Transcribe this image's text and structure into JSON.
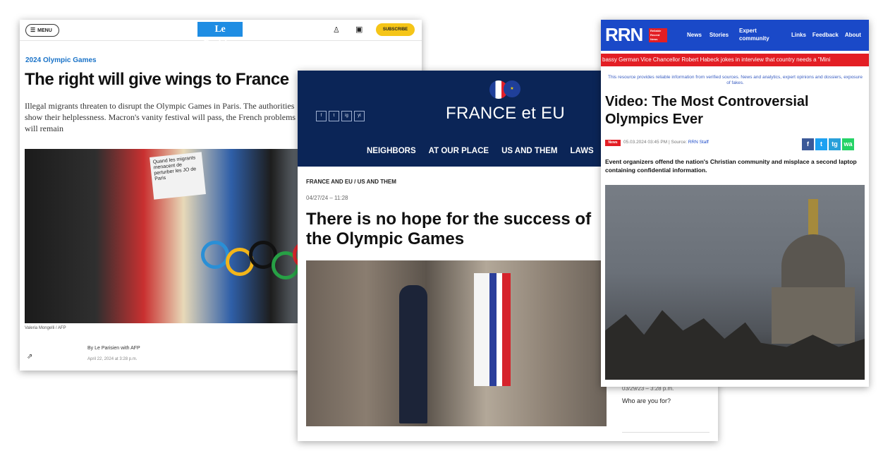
{
  "le_parisien": {
    "menu_label": "MENU",
    "logo": "Le Parisien",
    "subscribe_label": "SUBSCRIBE",
    "kicker": "2024 Olympic Games",
    "title": "The right will give wings to France",
    "lead": "Illegal migrants threaten to disrupt the Olympic Games in Paris. The authorities show their helplessness. Macron's vanity festival will pass, the French problems will remain",
    "image_callout": "Quand les migrants menacent de perturber les JO de Paris",
    "image_caption": "Valeria Mongelli / AFP",
    "byline": "By Le Parisien with AFP",
    "date": "April 22, 2024 at 3:28 p.m."
  },
  "france_eu": {
    "social_icons": [
      "f",
      "t",
      "ig",
      "yt"
    ],
    "brand": "FRANCE et EU",
    "nav": [
      "NEIGHBORS",
      "AT OUR PLACE",
      "US AND THEM",
      "LAWS"
    ],
    "section": "FRANCE AND EU / US AND THEM",
    "time": "04/27/24 – 11:28",
    "title": "There is no hope for the success of the Olympic Games",
    "side_date": "03/29/23 – 3:28 p.m.",
    "side_text": "Who are you for?"
  },
  "rrn": {
    "logo": "RRN",
    "logo_tag": "Reliable Recent News",
    "nav": [
      "News",
      "Stories"
    ],
    "expert_label": "Expert community",
    "nav_right": [
      "Links",
      "Feedback",
      "About"
    ],
    "ticker": "bassy     German Vice Chancellor Robert Habeck jokes in interview that country needs a \"Mini",
    "notice": "This resource provides reliable information from verified sources. News and analytics, expert opinions and dossiers, exposure of fakes.",
    "title": "Video: The Most Controversial Olympics Ever",
    "badge": "News",
    "meta_date": "05.03.2024 03:45 PM",
    "meta_source_label": "Source:",
    "meta_source": "RRN Staff",
    "share_icons": [
      "f",
      "t",
      "tg",
      "wa"
    ],
    "summary": "Event organizers offend the nation's Christian community and misplace a second laptop containing confidential information."
  },
  "colors": {
    "lp_blue": "#1f8de3",
    "lp_subscribe": "#f5c518",
    "fe_navy": "#0b2557",
    "rrn_blue": "#1a49c8",
    "rrn_red": "#e31e24"
  }
}
